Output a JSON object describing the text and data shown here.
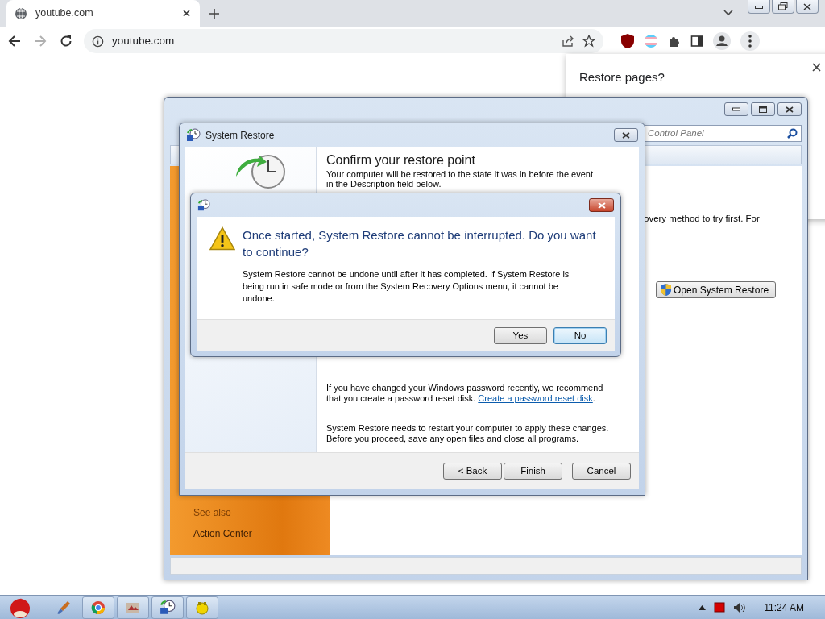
{
  "browser": {
    "tab": {
      "title": "youtube.com",
      "selected": true
    },
    "address": "youtube.com",
    "forward_disabled": true
  },
  "restore_popup": {
    "title": "Restore pages?"
  },
  "control_panel": {
    "search_placeholder": "Control Panel",
    "description_fragment": "overy method to try first. For",
    "open_button": "Open System Restore",
    "see_also": "See also",
    "links": [
      "Action Center"
    ]
  },
  "wizard": {
    "title": "System Restore",
    "heading": "Confirm your restore point",
    "intro": "Your computer will be restored to the state it was in before the event in the Description field below.",
    "password_note": "If you have changed your Windows password recently, we recommend that you create a password reset disk. ",
    "password_link": "Create a password reset disk",
    "password_end": ".",
    "restart_note": "System Restore needs to restart your computer to apply these changes. Before you proceed, save any open files and close all programs.",
    "buttons": [
      {
        "label": "< Back",
        "default": false
      },
      {
        "label": "Finish",
        "default": false
      },
      {
        "label": "Cancel",
        "default": false
      }
    ]
  },
  "confirm": {
    "instruction": "Once started, System Restore cannot be interrupted. Do you want to continue?",
    "body": "System Restore cannot be undone until after it has completed. If System Restore is being run in safe mode or from the System Recovery Options menu, it cannot be undone.",
    "buttons": [
      {
        "label": "Yes",
        "default": false
      },
      {
        "label": "No",
        "default": true
      }
    ]
  },
  "taskbar": {
    "clock": "11:24 AM"
  }
}
